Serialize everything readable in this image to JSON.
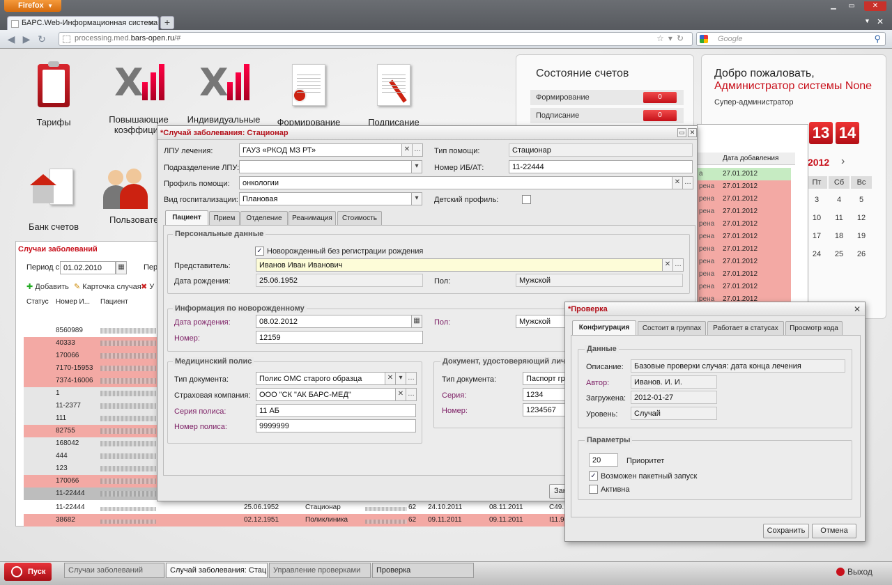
{
  "browser": {
    "menu_button": "Firefox",
    "tab_title": "БАРС.Web-Информационная система ...",
    "url_domain": "processing.med.",
    "url_host": "bars-open.ru",
    "url_path": "/#",
    "search_placeholder": "Google"
  },
  "desktop_icons": [
    {
      "label": "Тарифы"
    },
    {
      "label": "Повышающие коэффицие"
    },
    {
      "label": "Индивидуальные"
    },
    {
      "label": "Формирование"
    },
    {
      "label": "Подписание"
    },
    {
      "label": "Банк счетов"
    },
    {
      "label": "Пользовате"
    }
  ],
  "status_panel": {
    "title": "Состояние счетов",
    "rows": [
      {
        "label": "Формирование",
        "count": "0"
      },
      {
        "label": "Подписание",
        "count": "0"
      }
    ]
  },
  "welcome": {
    "greeting": "Добро пожаловать,",
    "user": "Администратор системы None",
    "role": "Супер-администратор",
    "clock_h": "13",
    "clock_m": "14",
    "cal_year": "2012",
    "cal_next": "›",
    "cal_heads": [
      "Пт",
      "Сб",
      "Вс"
    ],
    "cal_rows": [
      [
        "3",
        "4",
        "5"
      ],
      [
        "10",
        "11",
        "12"
      ],
      [
        "17",
        "18",
        "19"
      ],
      [
        "24",
        "25",
        "26"
      ]
    ]
  },
  "bg_list": {
    "title": "Случаи заболеваний",
    "period_label": "Период с:",
    "period_value": "01.02.2010",
    "period_to": "Пер",
    "add": "Добавить",
    "card": "Карточка случая",
    "del": "У",
    "col_status": "Статус",
    "col_num": "Номер И...",
    "col_patient": "Пациент",
    "rows": [
      "8560989",
      "40333",
      "170066",
      "7170-15953",
      "7374-16006",
      "1",
      "11-2377",
      "111",
      "82755",
      "168042",
      "444",
      "123",
      "170066",
      "11-22444"
    ]
  },
  "bg_right_list": {
    "col_date": "Дата добавления",
    "col_status_prefix": "",
    "rows": [
      {
        "st": "а",
        "date": "27.01.2012"
      },
      {
        "st": "рена",
        "date": "27.01.2012"
      },
      {
        "st": "рена",
        "date": "27.01.2012"
      },
      {
        "st": "рена",
        "date": "27.01.2012"
      },
      {
        "st": "рена",
        "date": "27.01.2012"
      },
      {
        "st": "рена",
        "date": "27.01.2012"
      },
      {
        "st": "рена",
        "date": "27.01.2012"
      },
      {
        "st": "рена",
        "date": "27.01.2012"
      },
      {
        "st": "рена",
        "date": "27.01.2012"
      },
      {
        "st": "рена",
        "date": "27.01.2012"
      },
      {
        "st": "рена",
        "date": "27.01.2012"
      }
    ]
  },
  "bottom_rows": [
    {
      "num": "11-22444",
      "date": "25.06.1952",
      "type": "Стационар",
      "code": "62",
      "d1": "24.10.2011",
      "d2": "08.11.2011",
      "diag": "C49."
    },
    {
      "num": "38682",
      "date": "02.12.1951",
      "type": "Поликлиника",
      "code": "62",
      "d1": "09.11.2011",
      "d2": "09.11.2011",
      "diag": "I11.9"
    }
  ],
  "case_window": {
    "title": "*Случай заболевания: Стационар",
    "lpu_label": "ЛПУ лечения:",
    "lpu_value": "ГАУЗ «РКОД МЗ РТ»",
    "help_type_label": "Тип помощи:",
    "help_type_value": "Стационар",
    "dept_label": "Подразделение ЛПУ:",
    "dept_value": "",
    "ib_label": "Номер ИБ/АТ:",
    "ib_value": "11-22444",
    "profile_label": "Профиль помощи:",
    "profile_value": "онкологии",
    "hosp_label": "Вид госпитализации:",
    "hosp_value": "Плановая",
    "child_label": "Детский профиль:",
    "tabs": [
      "Пациент",
      "Прием",
      "Отделение",
      "Реанимация",
      "Стоимость"
    ],
    "personal_legend": "Персональные данные",
    "newborn_cb": "Новорожденный без регистрации рождения",
    "rep_label": "Представитель:",
    "rep_value": "Иванов Иван Иванович",
    "birth_label": "Дата рождения:",
    "birth_value": "25.06.1952",
    "sex_label": "Пол:",
    "sex_value": "Мужской",
    "nb_legend": "Информация по новорожденному",
    "nb_birth_label": "Дата рождения:",
    "nb_birth_value": "08.02.2012",
    "nb_sex_label": "Пол:",
    "nb_sex_value": "Мужской",
    "nb_num_label": "Номер:",
    "nb_num_value": "12159",
    "policy_legend": "Медицинский полис",
    "doc_type_label": "Тип документа:",
    "doc_type_value": "Полис ОМС старого образца",
    "ins_label": "Страховая компания:",
    "ins_value": "ООО \"СК \"АК БАРС-МЕД\"",
    "series_label": "Серия полиса:",
    "series_value": "11 АБ",
    "pnum_label": "Номер полиса:",
    "pnum_value": "9999999",
    "id_legend": "Документ, удостоверяющий личн",
    "id_type_label": "Тип документа:",
    "id_type_value": "Паспорт гр",
    "id_series_label": "Серия:",
    "id_series_value": "1234",
    "id_num_label": "Номер:",
    "id_num_value": "1234567",
    "close_btn": "Зак"
  },
  "check_window": {
    "title": "*Проверка",
    "tabs": [
      "Конфигурация",
      "Состоит в группах",
      "Работает в статусах",
      "Просмотр кода"
    ],
    "data_legend": "Данные",
    "desc_label": "Описание:",
    "desc_value": "Базовые проверки случая: дата конца лечения",
    "author_label": "Автор:",
    "author_value": "Иванов. И. И.",
    "loaded_label": "Загружена:",
    "loaded_value": "2012-01-27",
    "level_label": "Уровень:",
    "level_value": "Случай",
    "params_legend": "Параметры",
    "priority_value": "20",
    "priority_label": "Приоритет",
    "batch_label": "Возможен пакетный запуск",
    "active_label": "Активна",
    "save_btn": "Сохранить",
    "cancel_btn": "Отмена"
  },
  "taskbar": {
    "start": "Пуск",
    "items": [
      "Случаи заболеваний",
      "Случай заболевания: Стационар",
      "Управление проверками",
      "Проверка"
    ],
    "exit": "Выход"
  },
  "colors": {
    "accent": "#c8101b",
    "pink_row": "#f3a9a4",
    "green_row": "#c6ebc2"
  }
}
